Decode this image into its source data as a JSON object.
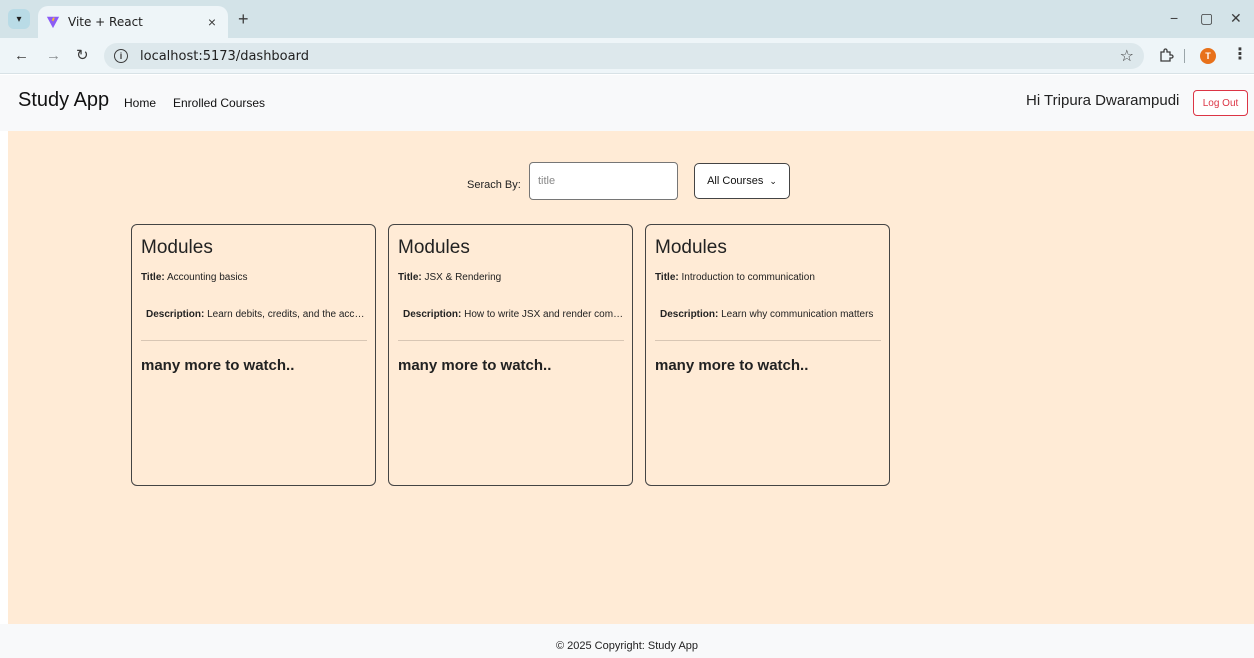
{
  "browser": {
    "tab_title": "Vite + React",
    "tab_close": "×",
    "new_tab": "+",
    "url": "localhost:5173/dashboard",
    "window_controls": {
      "minimize": "−",
      "restore": "▢",
      "close": "✕"
    },
    "profile_initial": "T",
    "icons": [
      "chevron-down-icon",
      "vite-logo-icon",
      "back-arrow-icon",
      "forward-arrow-icon",
      "reload-icon",
      "site-info-icon",
      "star-icon",
      "extensions-icon",
      "menu-icon"
    ]
  },
  "navbar": {
    "brand": "Study App",
    "links": {
      "home": "Home",
      "enrolled": "Enrolled Courses"
    },
    "greeting": "Hi Tripura Dwarampudi",
    "logout": "Log Out",
    "logout_color": "#dc3545"
  },
  "search": {
    "label": "Serach By:",
    "placeholder": "title",
    "filter_value": "All Courses"
  },
  "cards": [
    {
      "heading": "Modules",
      "title_label": "Title:",
      "title": "Accounting basics",
      "description_label": "Description:",
      "description": "Learn debits, credits, and the accounting equation",
      "more": "many more to watch.."
    },
    {
      "heading": "Modules",
      "title_label": "Title:",
      "title": "JSX & Rendering",
      "description_label": "Description:",
      "description": "How to write JSX and render components",
      "more": "many more to watch.."
    },
    {
      "heading": "Modules",
      "title_label": "Title:",
      "title": "Introduction to communication",
      "description_label": "Description:",
      "description": "Learn why communication matters",
      "more": "many more to watch.."
    }
  ],
  "footer": {
    "text": "© 2025 Copyright: Study App"
  },
  "colors": {
    "main_bg": "#ffebd6",
    "navbar_bg": "#f8f9fa",
    "chrome_bg": "#d3e3e8"
  }
}
